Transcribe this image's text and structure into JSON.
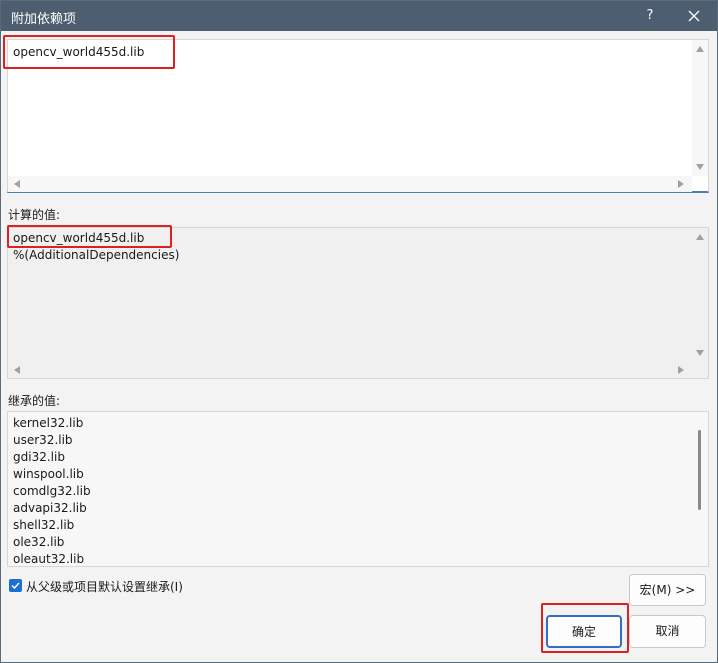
{
  "window": {
    "title": "附加依赖项",
    "help_label": "?"
  },
  "editor": {
    "lines": [
      "opencv_world455d.lib"
    ]
  },
  "computed": {
    "label": "计算的值:",
    "lines": [
      "opencv_world455d.lib",
      "%(AdditionalDependencies)"
    ]
  },
  "inherited": {
    "label": "继承的值:",
    "lines": [
      "kernel32.lib",
      "user32.lib",
      "gdi32.lib",
      "winspool.lib",
      "comdlg32.lib",
      "advapi32.lib",
      "shell32.lib",
      "ole32.lib",
      "oleaut32.lib"
    ]
  },
  "inherit_checkbox": {
    "label": "从父级或项目默认设置继承(I)",
    "checked": true
  },
  "buttons": {
    "macro": "宏(M) >>",
    "ok": "确定",
    "cancel": "取消"
  },
  "colors": {
    "titlebar": "#4c5e70",
    "highlight": "#e02020",
    "accent": "#1a6fd8"
  }
}
